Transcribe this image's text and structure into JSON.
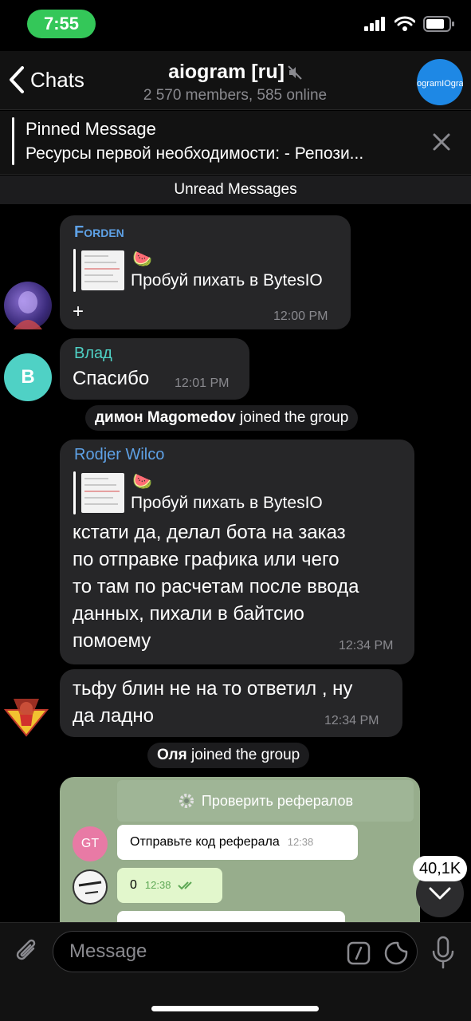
{
  "status": {
    "time": "7:55"
  },
  "header": {
    "back_label": "Chats",
    "title": "aiogram [ru]",
    "subtitle": "2 570 members, 585 online",
    "avatar_text": "AiogramIOgram"
  },
  "pinned": {
    "title": "Pinned Message",
    "text": "Ресурсы первой необходимости: - Репози..."
  },
  "unread_label": "Unread Messages",
  "messages": [
    {
      "sender": "Forden",
      "reply_text": "Пробуй пихать в BytesIO",
      "text": "+",
      "time": "12:00 PM",
      "sender_color": "#5ea1e6"
    },
    {
      "sender": "Влад",
      "avatar_letter": "B",
      "text": "Спасибо",
      "time": "12:01 PM",
      "sender_color": "#4fd1c5"
    },
    {
      "sender": "Rodjer Wilco",
      "reply_text": "Пробуй пихать в BytesIO",
      "text_lines": [
        "кстати да, делал бота на заказ",
        "по отправке графика или чего",
        "то там по расчетам после ввода",
        "данных, пихали в байтсио",
        "помоему"
      ],
      "time": "12:34 PM",
      "sender_color": "#5ea1e6"
    },
    {
      "text_lines": [
        "тьфу блин не на то ответил , ну",
        "да ладно"
      ],
      "time": "12:34 PM"
    }
  ],
  "services": [
    {
      "name": "димон Magomedov",
      "action": " joined the group"
    },
    {
      "name": "Оля",
      "action": " joined the group"
    }
  ],
  "photo": {
    "button": "Проверить рефералов",
    "bot_avatar": "GT",
    "bot_msg": "Отправьте код реферала",
    "bot_time": "12:38",
    "user_msg": "0",
    "user_time": "12:38"
  },
  "unread_counter": "40,1K",
  "input": {
    "placeholder": "Message"
  },
  "icons": [
    "chevron-left-icon",
    "mute-icon",
    "close-icon",
    "gear-icon",
    "double-check-icon",
    "chevron-down-icon",
    "paperclip-icon",
    "slash-command-icon",
    "sticker-icon",
    "microphone-icon",
    "signal-icon",
    "wifi-icon",
    "battery-icon"
  ]
}
